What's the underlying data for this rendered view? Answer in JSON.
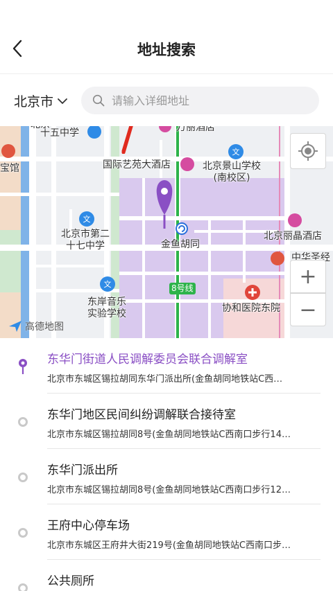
{
  "header": {
    "title": "地址搜索"
  },
  "search": {
    "city": "北京市",
    "placeholder": "请输入详细地址"
  },
  "map": {
    "pois": [
      {
        "id": "shiwu",
        "label": "十五中学"
      },
      {
        "id": "wanli",
        "label": "万丽酒店"
      },
      {
        "id": "yiyuan",
        "label": "国际艺苑大酒店"
      },
      {
        "id": "jingshan",
        "label": "北京景山学校\n(南校区)"
      },
      {
        "id": "baoguan",
        "label": "宝馆"
      },
      {
        "id": "no27",
        "label": "北京市第二\n十七中学"
      },
      {
        "id": "jinyu",
        "label": "金鱼胡同"
      },
      {
        "id": "liji",
        "label": "北京丽晶酒店"
      },
      {
        "id": "zhonghua",
        "label": "中华圣经"
      },
      {
        "id": "line8",
        "label": "8号线"
      },
      {
        "id": "dongan",
        "label": "东岸音乐\n实验学校"
      },
      {
        "id": "xiehe",
        "label": "协和医院东院"
      },
      {
        "id": "beijing_top",
        "label": "北京"
      }
    ],
    "logo_text": "高德地图",
    "controls": {
      "zoom_in": "+",
      "zoom_out": "−"
    },
    "colors": {
      "area": "#d9c9ee",
      "subway": "#2db34a",
      "road": "#ffffff",
      "water": "#7fb3e8",
      "park": "#cfe8cf",
      "pin": "#8a4fc4"
    }
  },
  "results": [
    {
      "name": "东华门街道人民调解委员会联合调解室",
      "address": "北京市东城区锡拉胡同东华门派出所(金鱼胡同地铁站C西…",
      "selected": true
    },
    {
      "name": "东华门地区民间纠纷调解联合接待室",
      "address": "北京市东城区锡拉胡同8号(金鱼胡同地铁站C西南口步行14…",
      "selected": false
    },
    {
      "name": "东华门派出所",
      "address": "北京市东城区锡拉胡同8号(金鱼胡同地铁站C西南口步行12…",
      "selected": false
    },
    {
      "name": "王府中心停车场",
      "address": "北京市东城区王府井大街219号(金鱼胡同地铁站C西南口步…",
      "selected": false
    },
    {
      "name": "公共厕所",
      "address": "",
      "selected": false
    }
  ],
  "accent_color": "#8a4fc4"
}
